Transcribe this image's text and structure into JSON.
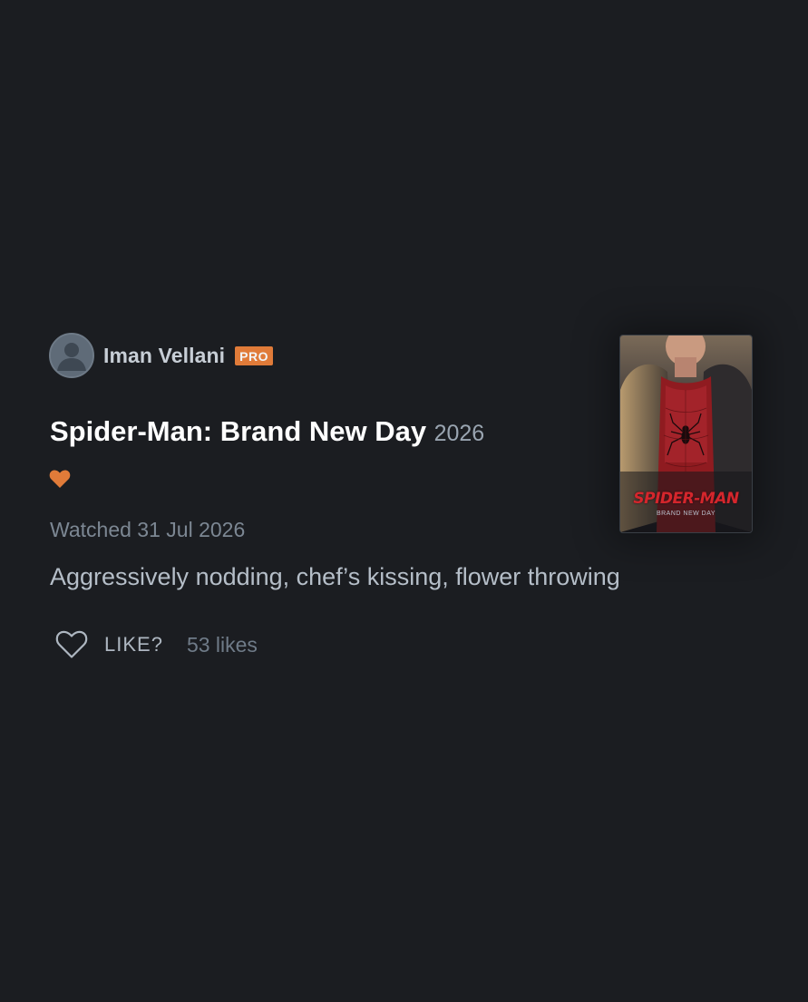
{
  "review": {
    "author": {
      "name": "Iman Vellani",
      "badge": "PRO",
      "avatar_icon": "person-avatar-icon"
    },
    "film": {
      "title": "Spider-Man: Brand New Day",
      "year": "2026",
      "liked": true,
      "liked_icon": "heart-filled-icon"
    },
    "watched": "Watched 31 Jul 2026",
    "text": "Aggressively nodding, chef’s kissing, flower throwing",
    "actions": {
      "like_icon": "heart-outline-icon",
      "like_label": "LIKE?",
      "likes_count": "53 likes"
    }
  },
  "poster": {
    "title": "SPIDER-MAN",
    "subtitle": "BRAND NEW DAY"
  },
  "colors": {
    "background": "#1b1d21",
    "accent_orange": "#e07b39",
    "text_primary": "#ffffff",
    "text_muted": "#7c8793"
  }
}
